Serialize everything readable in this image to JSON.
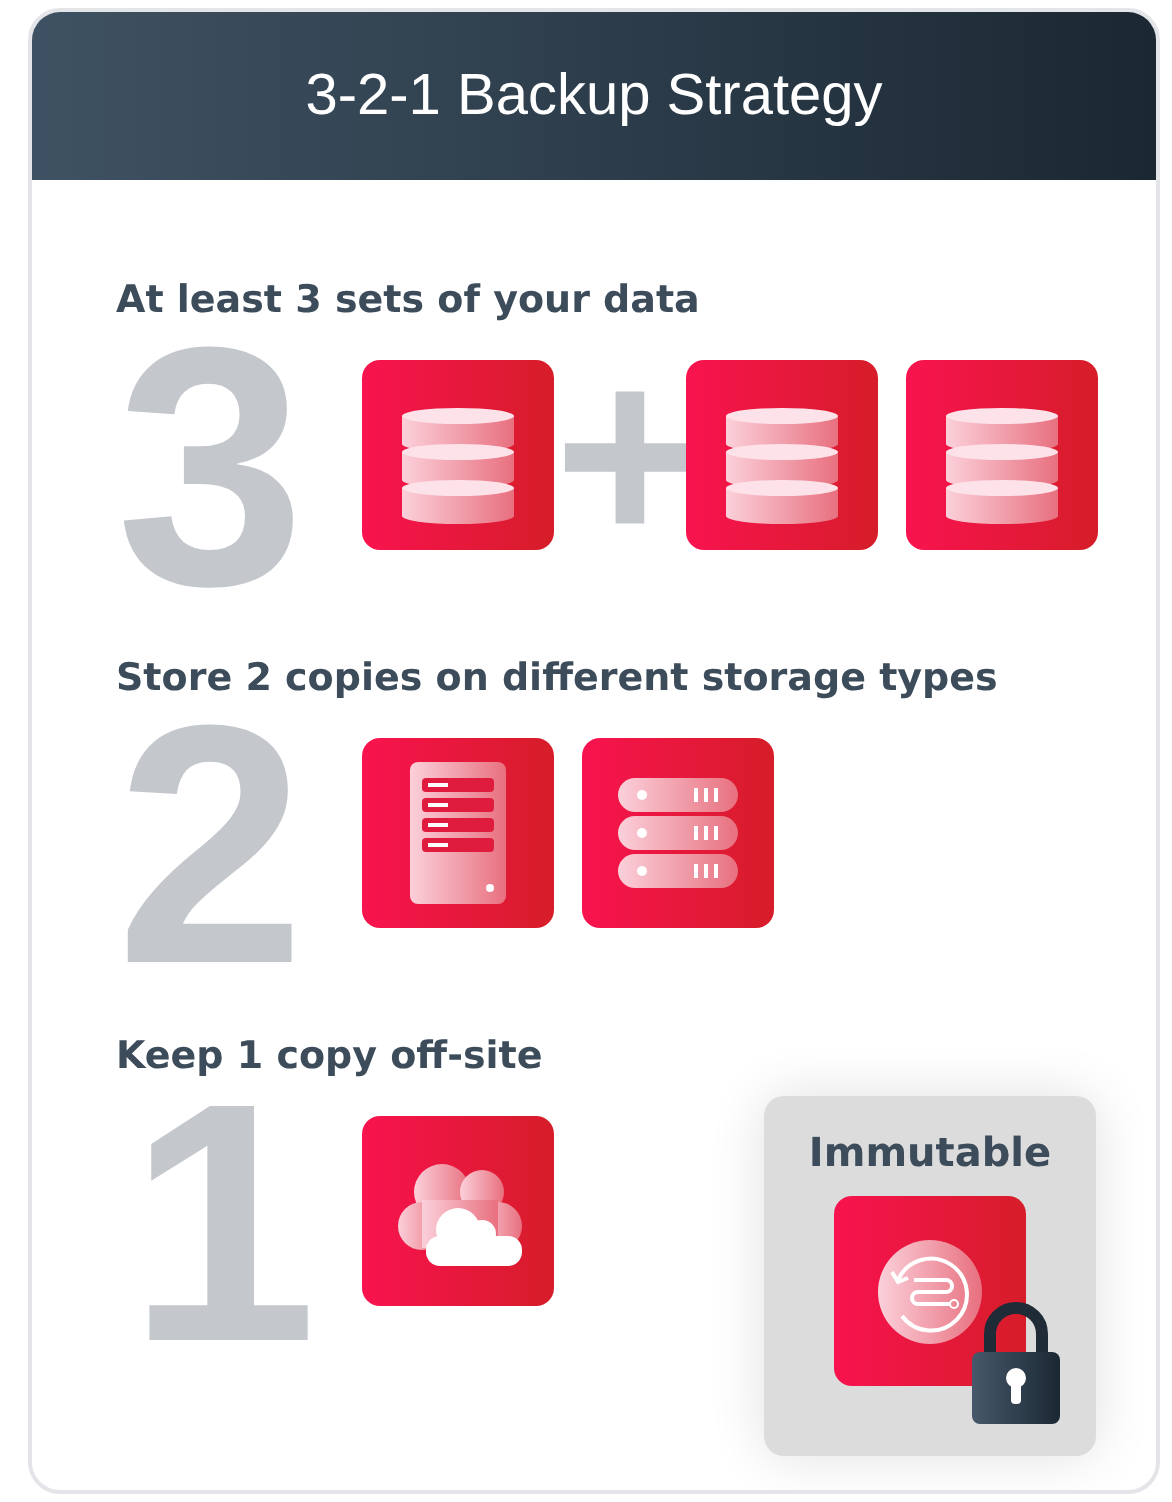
{
  "header": {
    "title": "3-2-1 Backup Strategy"
  },
  "steps": [
    {
      "numeral": "3",
      "heading": "At least 3 sets of your data",
      "items": [
        {
          "kind": "database"
        },
        {
          "kind": "plus",
          "text": "+"
        },
        {
          "kind": "database"
        },
        {
          "kind": "database"
        }
      ]
    },
    {
      "numeral": "2",
      "heading": "Store 2 copies on different storage types",
      "items": [
        {
          "kind": "tower"
        },
        {
          "kind": "rack"
        }
      ]
    },
    {
      "numeral": "1",
      "heading": "Keep 1 copy off-site",
      "items": [
        {
          "kind": "cloud"
        }
      ],
      "badge": {
        "label": "Immutable",
        "locked": true
      }
    }
  ]
}
